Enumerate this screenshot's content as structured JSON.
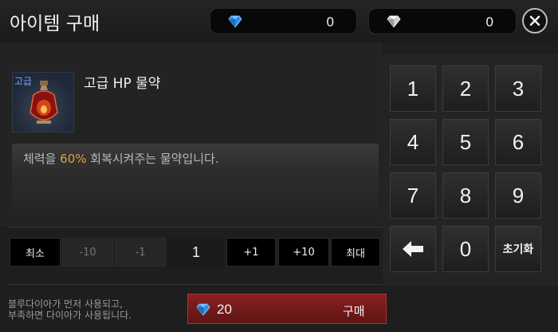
{
  "header": {
    "title": "아이템 구매",
    "blue_diamond": {
      "icon": "blue-diamond-icon",
      "amount": "0",
      "color": "#3fa9f5"
    },
    "diamond": {
      "icon": "white-diamond-icon",
      "amount": "0",
      "color": "#e8e8e8"
    },
    "close_icon": "close-icon"
  },
  "item": {
    "grade_label": "고급",
    "name": "고급 HP 물약",
    "description_prefix": "체력을 ",
    "description_highlight": "60%",
    "description_suffix": " 회복시켜주는 물약입니다.",
    "highlight_color": "#d9a63a"
  },
  "quantity": {
    "min_label": "최소",
    "minus10_label": "-10",
    "minus1_label": "-1",
    "value": "1",
    "plus1_label": "+1",
    "plus10_label": "+10",
    "max_label": "최대"
  },
  "keypad": {
    "k1": "1",
    "k2": "2",
    "k3": "3",
    "k4": "4",
    "k5": "5",
    "k6": "6",
    "k7": "7",
    "k8": "8",
    "k9": "9",
    "k0": "0",
    "backspace_icon": "backspace-arrow-icon",
    "reset_label": "초기화"
  },
  "footer": {
    "note_line1": "블루다이아가 먼저 사용되고,",
    "note_line2": "부족하면 다이아가 사용됩니다.",
    "price": "20",
    "buy_label": "구매",
    "buy_color": "#8a2020"
  }
}
